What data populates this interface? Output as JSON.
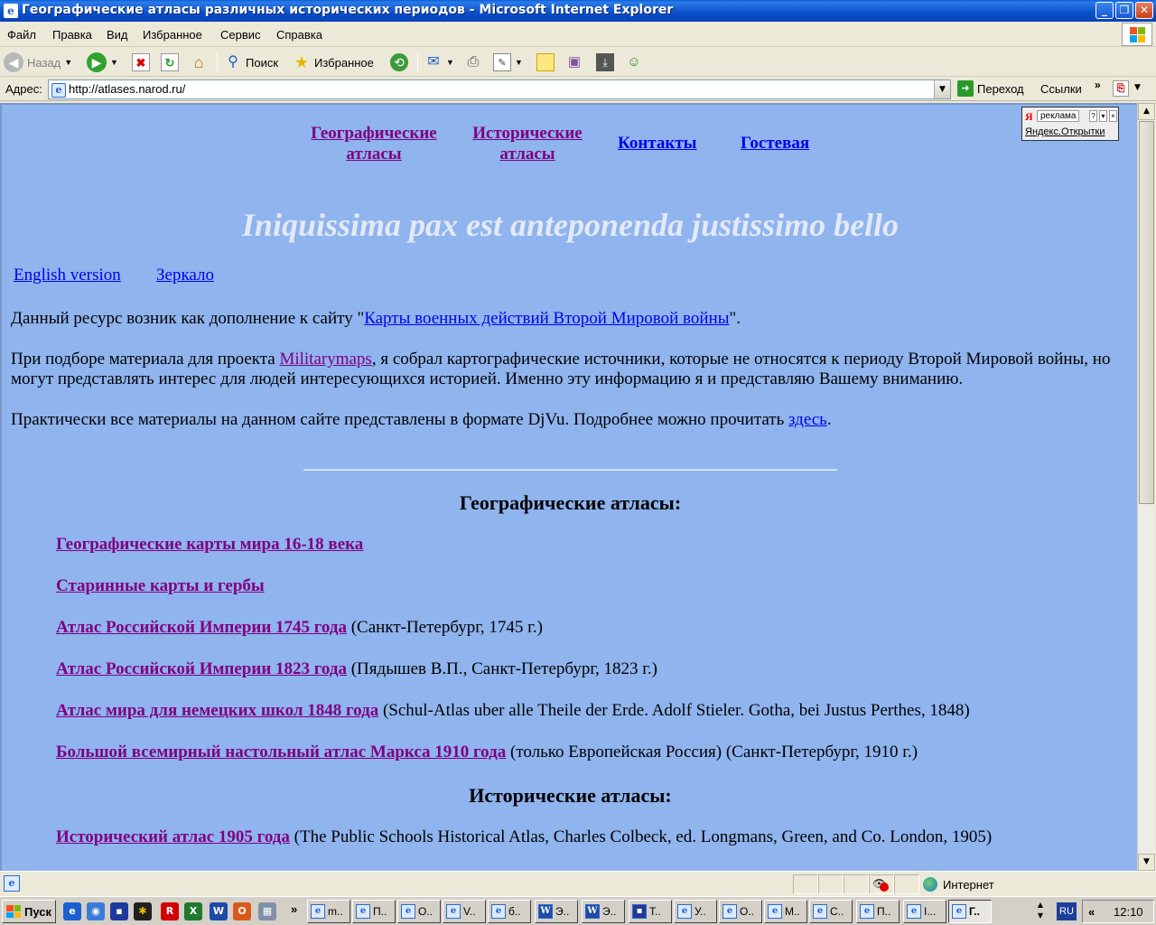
{
  "window": {
    "title": "Географические атласы различных исторических периодов - Microsoft Internet Explorer",
    "min_label": "_",
    "max_label": "❐",
    "close_label": "✕"
  },
  "menu": [
    "Файл",
    "Правка",
    "Вид",
    "Избранное",
    "Сервис",
    "Справка"
  ],
  "toolbar": {
    "back": "Назад",
    "search": "Поиск",
    "favorites": "Избранное"
  },
  "address": {
    "label": "Адрес:",
    "url": "http://atlases.narod.ru/",
    "go": "Переход",
    "links": "Ссылки",
    "chevron": "»"
  },
  "yandex": {
    "logo": "Я",
    "ad_label": "реклама",
    "link": "Яндекс.Открытки"
  },
  "nav": {
    "geo_line1": "Географические",
    "geo_line2": "атласы",
    "hist_line1": "Исторические",
    "hist_line2": "атласы",
    "contacts": "Контакты",
    "guestbook": "Гостевая"
  },
  "motto": "Iniquissima pax est anteponenda justissimo bello",
  "lang_links": {
    "english": "English version",
    "mirror": "Зеркало"
  },
  "intro": {
    "p1_before": "Данный ресурс возник как дополнение к сайту \"",
    "p1_link": "Карты военных действий Второй Мировой войны",
    "p1_after": "\".",
    "p2_before": "При подборе материала для проекта ",
    "p2_link": "Militarymaps",
    "p2_after": ", я собрал картографические источники, которые не относятся к периоду Второй Мировой войны, но могут представлять интерес для людей интересующихся историей. Именно эту информацию я и представляю Вашему вниманию.",
    "p3_before": "Практически все материалы на данном сайте представлены в формате DjVu. Подробнее можно прочитать ",
    "p3_link": "здесь",
    "p3_after": "."
  },
  "geo_section": {
    "title": "Географические атласы:",
    "items": [
      {
        "link": "Географические карты мира 16-18 века",
        "note": ""
      },
      {
        "link": "Старинные карты и гербы",
        "note": ""
      },
      {
        "link": "Атлас Российской Империи 1745 года",
        "note": " (Санкт-Петербург, 1745 г.)"
      },
      {
        "link": "Атлас Российской Империи 1823 года",
        "note": " (Пядышев В.П., Санкт-Петербург, 1823 г.)"
      },
      {
        "link": "Атлас мира для немецких школ 1848 года",
        "note": " (Schul-Atlas uber alle Theile der Erde. Adolf Stieler. Gotha, bei Justus Perthes, 1848)"
      },
      {
        "link": "Большой всемирный настольный атлас Маркса 1910 года",
        "note": " (только Европейская Россия) (Санкт-Петербург, 1910 г.)"
      }
    ]
  },
  "hist_section": {
    "title": "Исторические атласы:",
    "items": [
      {
        "link": "Исторический атлас 1905 года",
        "note": " (The Public Schools Historical Atlas, Charles Colbeck, ed. Longmans, Green, and Co. London, 1905)"
      }
    ]
  },
  "status": {
    "zone": "Интернет"
  },
  "taskbar": {
    "start": "Пуск",
    "tasks": [
      "m..",
      "П..",
      "О..",
      "V..",
      "б..",
      "Э..",
      "Э..",
      "Т..",
      "У..",
      "О..",
      "М..",
      "С..",
      "П..",
      "I...",
      "Г.."
    ],
    "lang": "RU",
    "tray_chevron": "«",
    "clock": "12:10"
  }
}
